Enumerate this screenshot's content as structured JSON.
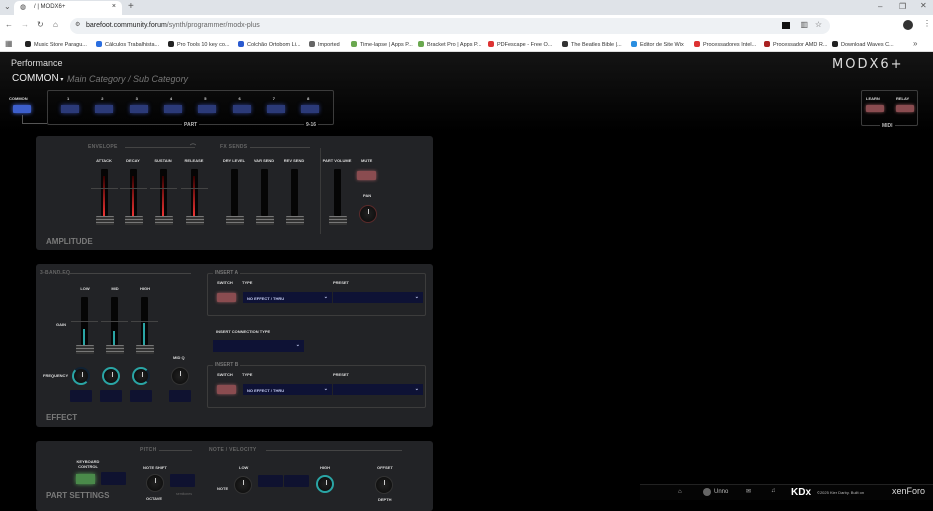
{
  "browser": {
    "tab_title": "/ | MODX6+",
    "url_host": "barefoot.community.forum",
    "url_path": "/synth/programmer/modx-plus",
    "bookmarks": [
      "Music Store Paragu...",
      "Cálculos Trabalhista...",
      "Pro Tools 10 key co...",
      "Colchão Ortobom Li...",
      "Imported",
      "Time-lapse | Apps P...",
      "Bracket Pro | Apps P...",
      "PDFescape - Free O...",
      "The Beatles Bible |...",
      "Editor de Site Wix",
      "Processadores Intel...",
      "Processador AMD R...",
      "Download Waves C..."
    ],
    "bookmark_colors": [
      "#222",
      "#2a6ee0",
      "#222",
      "#2a5ad0",
      "#666",
      "#6aa84f",
      "#6aa84f",
      "#d33",
      "#333",
      "#2a8ee0",
      "#d33",
      "#a22",
      "#222"
    ]
  },
  "header": {
    "title": "Performance",
    "selector": "COMMON",
    "category": "Main Category / Sub Category",
    "logo": "MODX6+"
  },
  "parts": {
    "common_label": "COMMON",
    "numbers": [
      "1",
      "2",
      "3",
      "4",
      "5",
      "6",
      "7",
      "8"
    ],
    "part_label": "PART",
    "more_label": "9-16"
  },
  "midi": {
    "learn": "LEARN",
    "relay": "RELAY",
    "label": "MIDI"
  },
  "amplitude": {
    "title": "AMPLITUDE",
    "envelope_label": "ENVELOPE",
    "fx_label": "FX SENDS",
    "faders": [
      {
        "label": "ATTACK",
        "red": true
      },
      {
        "label": "DECAY",
        "red": true
      },
      {
        "label": "SUSTAIN",
        "red": true
      },
      {
        "label": "RELEASE",
        "red": true
      },
      {
        "label": "DRY LEVEL",
        "red": false
      },
      {
        "label": "VAR SEND",
        "red": false
      },
      {
        "label": "REV SEND",
        "red": false
      },
      {
        "label": "PART VOLUME",
        "red": false
      }
    ],
    "mute": "MUTE",
    "pan": "PAN"
  },
  "effect": {
    "title": "EFFECT",
    "eq_label": "3-BAND EQ",
    "gain": "GAIN",
    "frequency": "FREQUENCY",
    "mid_q": "MID Q",
    "bands": [
      "LOW",
      "MID",
      "HIGH"
    ],
    "insert_a": {
      "label": "INSERT A",
      "switch": "SWITCH",
      "type": "TYPE",
      "preset": "PRESET",
      "type_value": "NO EFFECT / THRU"
    },
    "connection_label": "INSERT CONNECTION TYPE",
    "insert_b": {
      "label": "INSERT B",
      "switch": "SWITCH",
      "type": "TYPE",
      "preset": "PRESET",
      "type_value": "NO EFFECT / THRU"
    }
  },
  "part_settings": {
    "title": "PART SETTINGS",
    "keyboard_control": "KEYBOARD CONTROL",
    "pitch": "PITCH",
    "note_velocity": "NOTE / VELOCITY",
    "note_shift": "NOTE SHIFT",
    "octave": "OCTAVE",
    "semitones": "semitones",
    "note": "NOTE",
    "low": "LOW",
    "high": "HIGH",
    "offset": "OFFSET",
    "depth": "DEPTH"
  },
  "footer": {
    "user": "Unno",
    "copyright": "©2025 Kier Darby. Built on",
    "brand": "KDx",
    "platform": "xenForo"
  }
}
